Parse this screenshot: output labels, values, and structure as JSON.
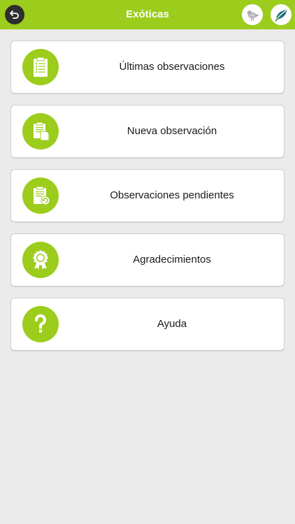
{
  "header": {
    "title": "Exóticas",
    "back_icon": "back-arrow-icon",
    "left_logo_icon": "bird-logo-icon",
    "right_logo_icon": "leaf-logo-icon"
  },
  "colors": {
    "accent": "#9ccc1c",
    "background": "#ebebeb",
    "card": "#ffffff",
    "text": "#1a1a1a"
  },
  "menu": {
    "items": [
      {
        "label": "Últimas observaciones",
        "icon": "clipboard-list-icon"
      },
      {
        "label": "Nueva observación",
        "icon": "new-document-icon"
      },
      {
        "label": "Observaciones pendientes",
        "icon": "pending-documents-icon"
      },
      {
        "label": "Agradecimientos",
        "icon": "award-ribbon-icon"
      },
      {
        "label": "Ayuda",
        "icon": "question-mark-icon"
      }
    ]
  }
}
